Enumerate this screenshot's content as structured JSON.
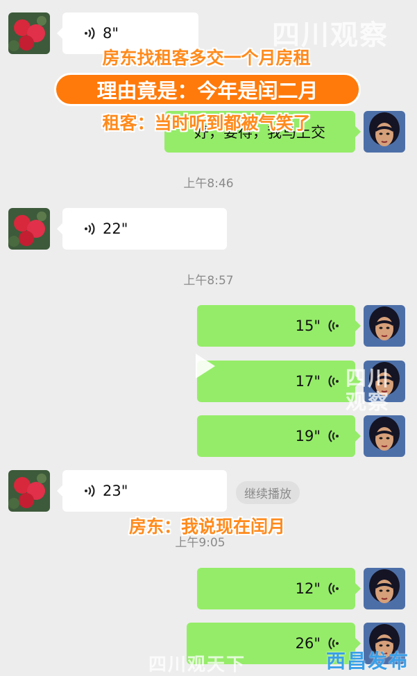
{
  "colors": {
    "incoming_bubble": "#ffffff",
    "outgoing_bubble": "#95ec69",
    "background": "#ededed",
    "caption_orange": "#ff8a1c"
  },
  "messages": [
    {
      "side": "in",
      "duration": "8\""
    },
    {
      "side": "out",
      "text": "好，要得，我马上交"
    },
    {
      "side": "in",
      "duration": "22\""
    },
    {
      "side": "out",
      "duration": "15\""
    },
    {
      "side": "out",
      "duration": "17\""
    },
    {
      "side": "out",
      "duration": "19\""
    },
    {
      "side": "in",
      "duration": "23\"",
      "action": "继续播放"
    },
    {
      "side": "out",
      "duration": "12\""
    },
    {
      "side": "out",
      "duration": "26\""
    }
  ],
  "timestamps": [
    "上午8:46",
    "上午8:57",
    "上午9:05"
  ],
  "captions": {
    "line1": "房东找租客多交一个月房租",
    "line2": "理由竟是：今年是闰二月",
    "line3": "租客：当时听到都被气笑了",
    "line4": "房东：我说现在闰月"
  },
  "watermarks": {
    "top": "四川观察",
    "middle": "四川观察",
    "bottom": "四川观天下",
    "corner": "西昌发布"
  }
}
